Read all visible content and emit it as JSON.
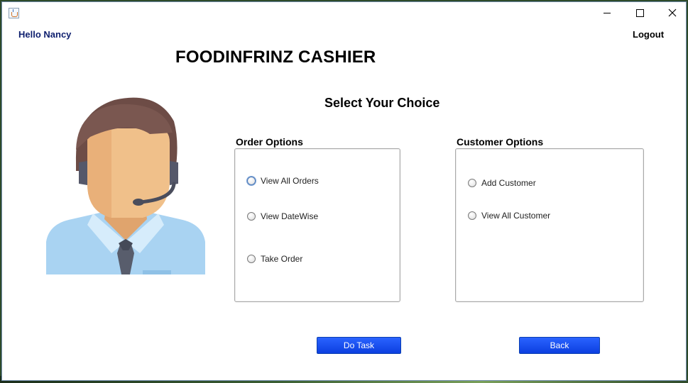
{
  "window": {
    "app_icon": "java-cup-icon"
  },
  "header": {
    "greeting": "Hello Nancy",
    "logout_label": "Logout",
    "title": "FOODINFRINZ CASHIER",
    "subtitle": "Select Your Choice"
  },
  "order_options": {
    "label": "Order Options",
    "items": [
      {
        "label": "View All Orders"
      },
      {
        "label": "View DateWise"
      },
      {
        "label": "Take Order"
      }
    ]
  },
  "customer_options": {
    "label": "Customer Options",
    "items": [
      {
        "label": "Add Customer"
      },
      {
        "label": "View All Customer"
      }
    ]
  },
  "actions": {
    "do_task_label": "Do Task",
    "back_label": "Back"
  },
  "colors": {
    "accent_button": "#1443f0",
    "greeting_text": "#0e1f6e"
  }
}
